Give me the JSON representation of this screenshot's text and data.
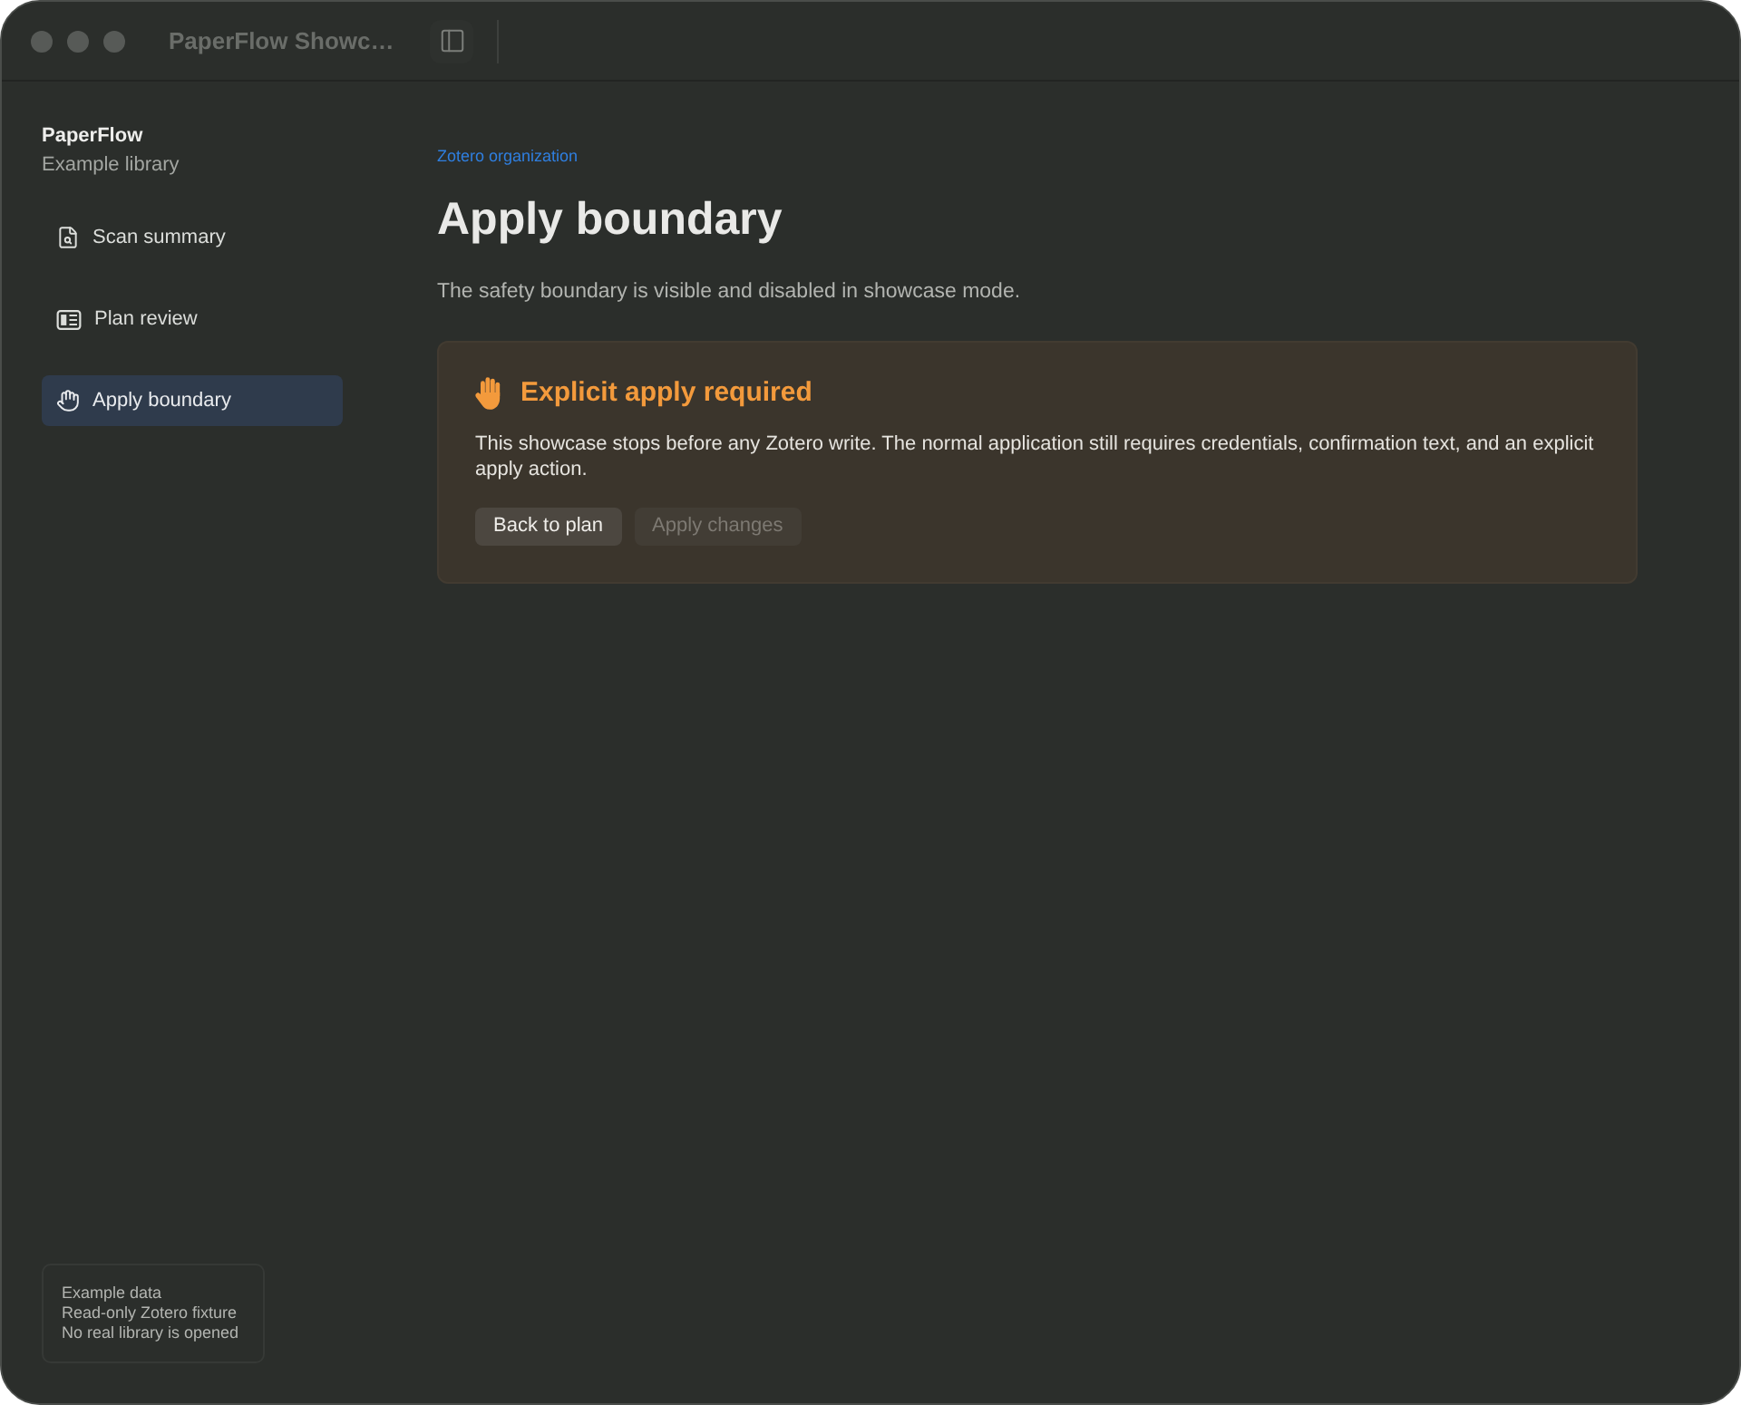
{
  "window": {
    "title": "PaperFlow Showc…"
  },
  "sidebar": {
    "app_name": "PaperFlow",
    "subtitle": "Example library",
    "items": [
      {
        "label": "Scan summary",
        "selected": false
      },
      {
        "label": "Plan review",
        "selected": false
      },
      {
        "label": "Apply boundary",
        "selected": true
      }
    ],
    "footer": [
      "Example data",
      "Read-only Zotero fixture",
      "No real library is opened"
    ]
  },
  "main": {
    "breadcrumb": "Zotero organization",
    "title": "Apply boundary",
    "description": "The safety boundary is visible and disabled in showcase mode.",
    "notice": {
      "title": "Explicit apply required",
      "body": "This showcase stops before any Zotero write. The normal application still requires credentials, confirmation text, and an explicit apply action.",
      "buttons": [
        {
          "label": "Back to plan",
          "disabled": false
        },
        {
          "label": "Apply changes",
          "disabled": true
        }
      ]
    }
  }
}
